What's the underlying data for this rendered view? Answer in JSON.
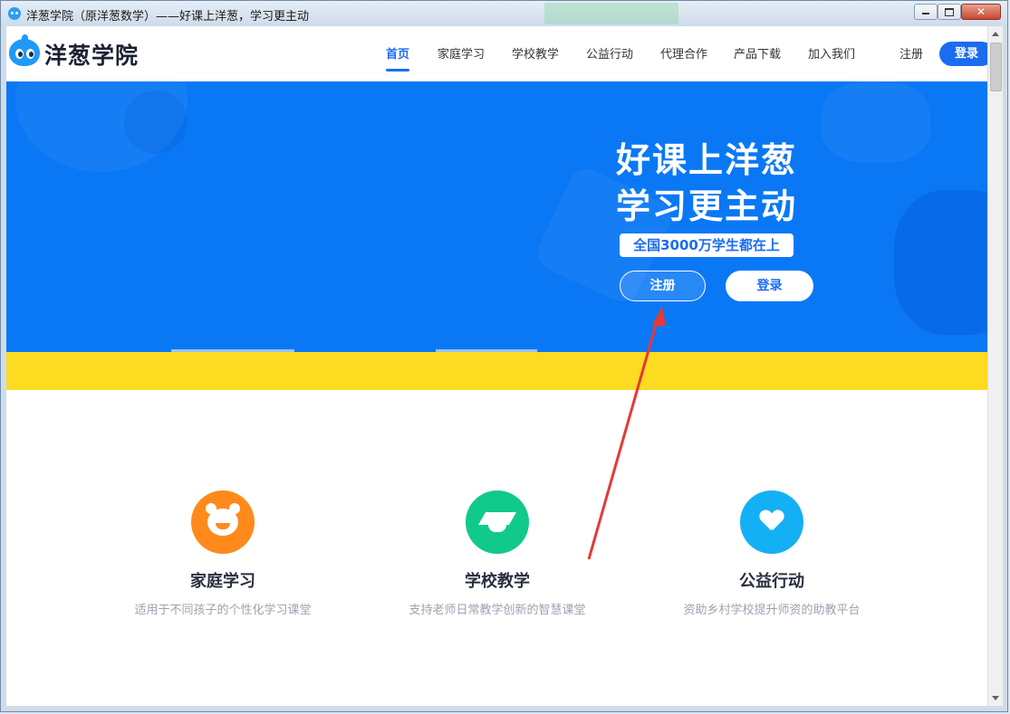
{
  "window": {
    "title": "洋葱学院（原洋葱数学）——好课上洋葱，学习更主动"
  },
  "nav": {
    "logo_text": "洋葱学院",
    "items": [
      {
        "label": "首页",
        "active": true
      },
      {
        "label": "家庭学习"
      },
      {
        "label": "学校教学"
      },
      {
        "label": "公益行动"
      },
      {
        "label": "代理合作"
      },
      {
        "label": "产品下载"
      },
      {
        "label": "加入我们"
      }
    ],
    "register": "注册",
    "login": "登录"
  },
  "hero": {
    "title_line1": "好课上洋葱",
    "title_line2": "学习更主动",
    "subtitle": "全国3000万学生都在上",
    "register_button": "注册",
    "login_button": "登录"
  },
  "features": [
    {
      "name": "家庭学习",
      "desc": "适用于不同孩子的个性化学习课堂",
      "icon": "bear-icon",
      "color": "#ff8a1c"
    },
    {
      "name": "学校教学",
      "desc": "支持老师日常教学创新的智慧课堂",
      "icon": "graduation-cap-icon",
      "color": "#11c98a"
    },
    {
      "name": "公益行动",
      "desc": "资助乡村学校提升师资的助教平台",
      "icon": "heart-icon",
      "color": "#14b0f5"
    }
  ],
  "colors": {
    "brand_blue": "#1a6cf0",
    "hero_blue": "#0a78f5",
    "yellow": "#fddb21",
    "annotation_red": "#e53935"
  }
}
